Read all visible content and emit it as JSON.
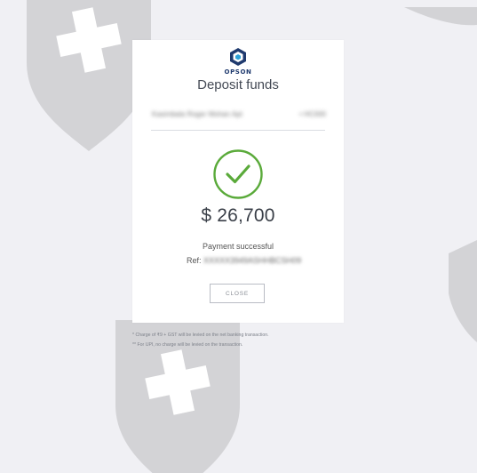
{
  "brand": {
    "logo_text": "OPSON",
    "logo_color": "#1f3a6e",
    "logo_accent": "#2fa3d8"
  },
  "dialog": {
    "title": "Deposit funds",
    "account_name": "Kasimbala Roger Mohan Apt",
    "account_number": "• HC000",
    "amount": "$ 26,700",
    "status_text": "Payment successful",
    "ref_label": "Ref:",
    "ref_value": "XXXXX3949ASHHBCSH09",
    "close_label": "CLOSE",
    "success_color": "#5aaa3a"
  },
  "notes": [
    "* Charge of ₹9 + GST will be levied on the net banking transaction.",
    "** For UPI, no charge will be levied on the transaction."
  ],
  "background": {
    "shield_icon": "shield-cross-icon",
    "shield_color": "#d3d3d6"
  }
}
